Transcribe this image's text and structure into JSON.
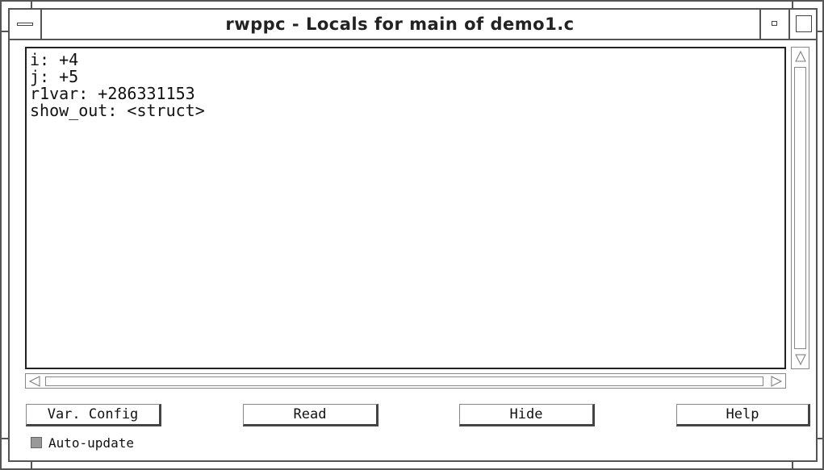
{
  "window": {
    "title": "rwppc - Locals for main of demo1.c"
  },
  "locals": {
    "lines": [
      "i: +4",
      "j: +5",
      "r1var: +286331153",
      "show_out: <struct>"
    ]
  },
  "buttons": {
    "var_config": "Var. Config",
    "read": "Read",
    "hide": "Hide",
    "help": "Help"
  },
  "options": {
    "auto_update_label": "Auto-update",
    "auto_update_checked": false
  },
  "icons": {
    "window_menu": "window-menu-icon",
    "minimize": "minimize-icon",
    "maximize": "maximize-icon",
    "scroll_up": "arrow-up-icon",
    "scroll_down": "arrow-down-icon",
    "scroll_left": "arrow-left-icon",
    "scroll_right": "arrow-right-icon"
  }
}
